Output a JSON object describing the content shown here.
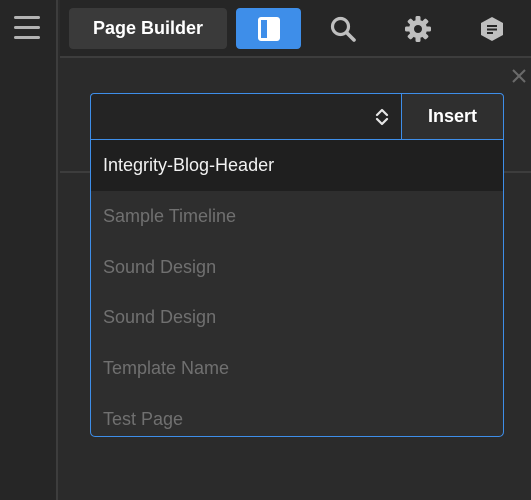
{
  "toolbar": {
    "page_builder_label": "Page Builder",
    "icons": [
      "menu-icon",
      "layout-panel-icon",
      "search-icon",
      "gear-icon",
      "document-hexagon-icon",
      "close-icon"
    ]
  },
  "colors": {
    "accent": "#3e8ee9",
    "background": "#2b2b2b",
    "rail": "#262626",
    "option_text": "#707070",
    "selected_text": "#f2f2f2"
  },
  "select": {
    "current_value": "",
    "insert_label": "Insert"
  },
  "dropdown": {
    "options": [
      {
        "label": "Integrity-Blog-Header",
        "highlighted": true
      },
      {
        "label": "Sample Timeline",
        "highlighted": false
      },
      {
        "label": "Sound Design",
        "highlighted": false
      },
      {
        "label": "Sound Design",
        "highlighted": false
      },
      {
        "label": "Template Name",
        "highlighted": false
      },
      {
        "label": "Test Page",
        "highlighted": false
      }
    ]
  }
}
